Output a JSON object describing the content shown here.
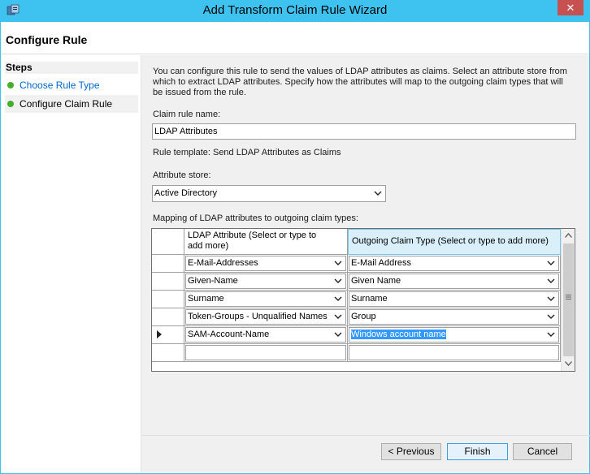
{
  "window": {
    "title": "Add Transform Claim Rule Wizard",
    "close_glyph": "✕"
  },
  "header": {
    "title": "Configure Rule"
  },
  "steps": {
    "heading": "Steps",
    "items": [
      {
        "label": "Choose Rule Type"
      },
      {
        "label": "Configure Claim Rule"
      }
    ]
  },
  "content": {
    "intro": "You can configure this rule to send the values of LDAP attributes as claims. Select an attribute store from which to extract LDAP attributes. Specify how the attributes will map to the outgoing claim types that will be issued from the rule.",
    "claim_rule_name_label": "Claim rule name:",
    "claim_rule_name_value": "LDAP Attributes",
    "rule_template": "Rule template: Send LDAP Attributes as Claims",
    "attribute_store_label": "Attribute store:",
    "attribute_store_value": "Active Directory",
    "mapping_label": "Mapping of LDAP attributes to outgoing claim types:"
  },
  "grid": {
    "col1_header_line1": "LDAP Attribute (Select or type to",
    "col1_header_line2": "add more)",
    "col2_header": "Outgoing Claim Type (Select or type to add more)",
    "rows": [
      {
        "ldap": "E-Mail-Addresses",
        "claim": "E-Mail Address"
      },
      {
        "ldap": "Given-Name",
        "claim": "Given Name"
      },
      {
        "ldap": "Surname",
        "claim": "Surname"
      },
      {
        "ldap": "Token-Groups - Unqualified Names",
        "claim": "Group"
      },
      {
        "ldap": "SAM-Account-Name",
        "claim": "Windows account name"
      }
    ]
  },
  "buttons": {
    "previous": "< Previous",
    "finish": "Finish",
    "cancel": "Cancel"
  },
  "colors": {
    "accent": "#3ec3f0",
    "selection": "#3399ff",
    "step_dot": "#43b02a",
    "link": "#0066cc"
  }
}
